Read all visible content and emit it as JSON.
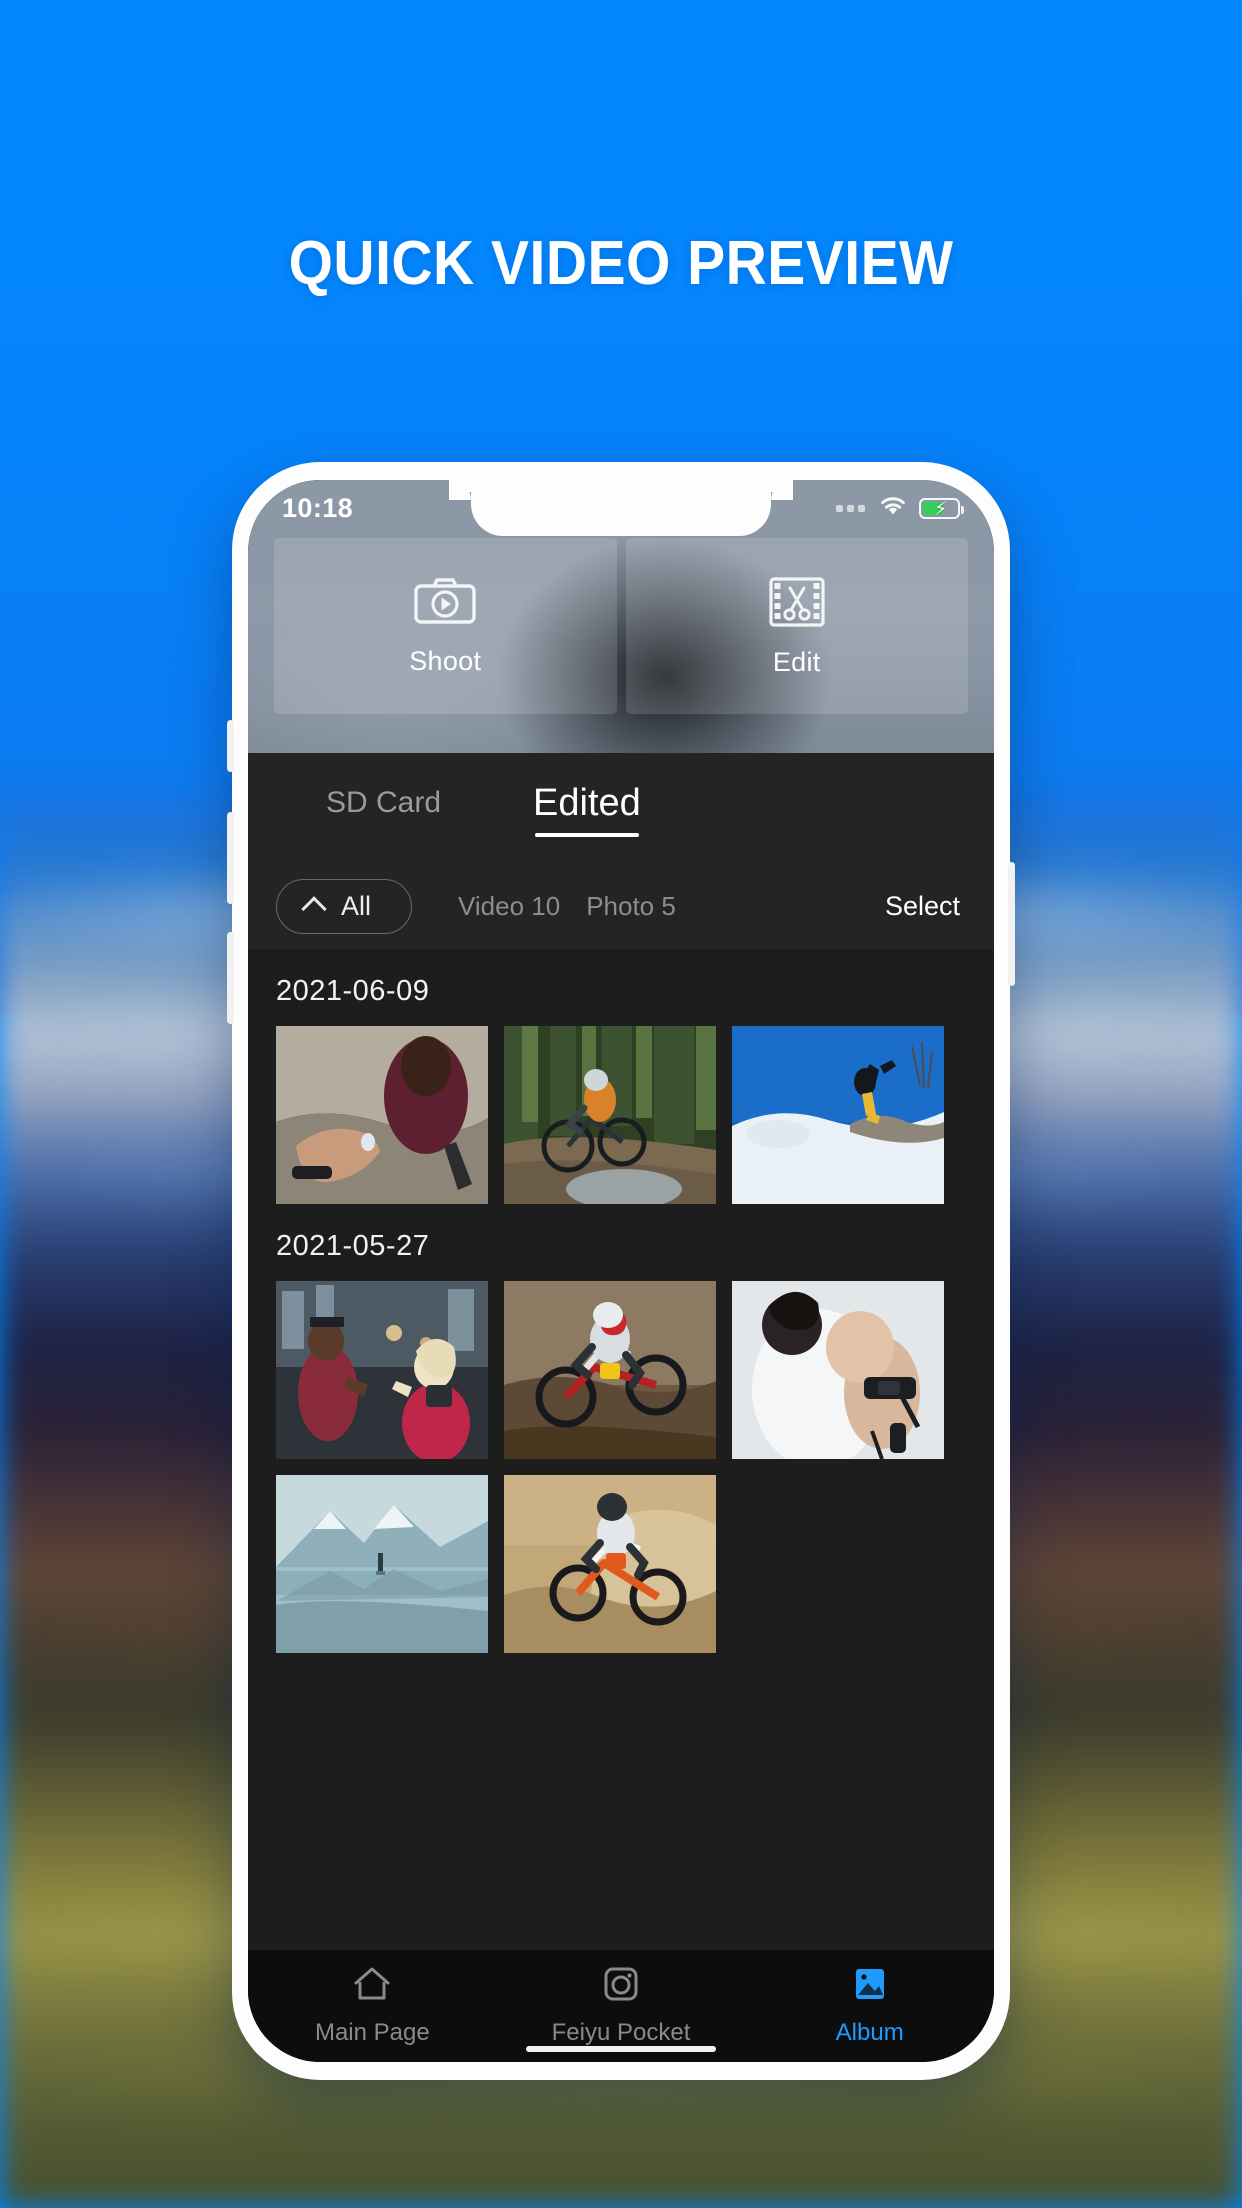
{
  "headline": "QUICK VIDEO PREVIEW",
  "colors": {
    "background_blue": "#0086fb",
    "accent_blue": "#1f9bff",
    "battery_green": "#31d158",
    "album_bg": "#1d1d1d",
    "header_bg": "#242424",
    "nav_bg": "#0d0d0d"
  },
  "status_bar": {
    "time": "10:18",
    "wifi_icon": "wifi-icon",
    "battery_icon": "battery-charging-icon",
    "signal_icon": "signal-dots-icon"
  },
  "quick_actions": [
    {
      "label": "Shoot",
      "icon": "camera-play-icon"
    },
    {
      "label": "Edit",
      "icon": "film-scissors-icon"
    }
  ],
  "tabs": [
    {
      "label": "SD Card",
      "active": false
    },
    {
      "label": "Edited",
      "active": true
    }
  ],
  "filter_bar": {
    "chip_label": "All",
    "chip_icon": "chevron-up-icon",
    "video_count": "Video 10",
    "photo_count": "Photo 5",
    "select_label": "Select"
  },
  "sections": [
    {
      "date": "2021-06-09",
      "thumbnails": [
        {
          "name": "thumb-couple-hands",
          "alt": "Couple holding hands on rock"
        },
        {
          "name": "thumb-mountain-biker",
          "alt": "Mountain biker in forest trail"
        },
        {
          "name": "thumb-snowboarder",
          "alt": "Snowboarder jumping over snow ledge"
        }
      ]
    },
    {
      "date": "2021-05-27",
      "thumbnails": [
        {
          "name": "thumb-street-couple",
          "alt": "Two people on a street at dusk"
        },
        {
          "name": "thumb-motocross-air",
          "alt": "Motocross rider mid-air"
        },
        {
          "name": "thumb-arm-strap",
          "alt": "Athlete with arm band device"
        },
        {
          "name": "thumb-lake-mountain",
          "alt": "Person on lake with mountain"
        },
        {
          "name": "thumb-dirtbike-dust",
          "alt": "Dirt bike kicking up dust"
        }
      ]
    }
  ],
  "bottom_nav": [
    {
      "label": "Main Page",
      "icon": "home-icon",
      "active": false
    },
    {
      "label": "Feiyu Pocket",
      "icon": "camera-icon",
      "active": false
    },
    {
      "label": "Album",
      "icon": "image-icon",
      "active": true
    }
  ]
}
